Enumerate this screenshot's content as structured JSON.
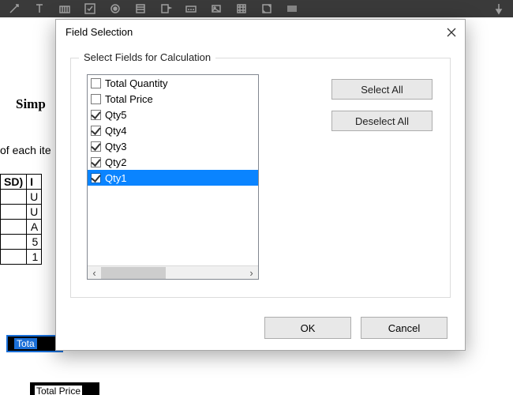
{
  "dialog": {
    "title": "Field Selection",
    "group_label": "Select Fields for Calculation",
    "select_all": "Select All",
    "deselect_all": "Deselect All",
    "ok": "OK",
    "cancel": "Cancel",
    "fields": [
      {
        "label": "Total Quantity",
        "checked": false,
        "selected": false
      },
      {
        "label": "Total Price",
        "checked": false,
        "selected": false
      },
      {
        "label": "Qty5",
        "checked": true,
        "selected": false
      },
      {
        "label": "Qty4",
        "checked": true,
        "selected": false
      },
      {
        "label": "Qty3",
        "checked": true,
        "selected": false
      },
      {
        "label": "Qty2",
        "checked": true,
        "selected": false
      },
      {
        "label": "Qty1",
        "checked": true,
        "selected": true
      }
    ]
  },
  "background": {
    "heading_fragment": "Simp",
    "body_fragment": "of each ite",
    "col_header_fragment": "SD)",
    "col2_header_fragment": "I",
    "cell_fragments": [
      "U",
      "U",
      "A",
      "5",
      "1"
    ],
    "field_label1": "Tota",
    "field_label2": "Total Price"
  },
  "scroll_arrows": {
    "left": "‹",
    "right": "›"
  }
}
